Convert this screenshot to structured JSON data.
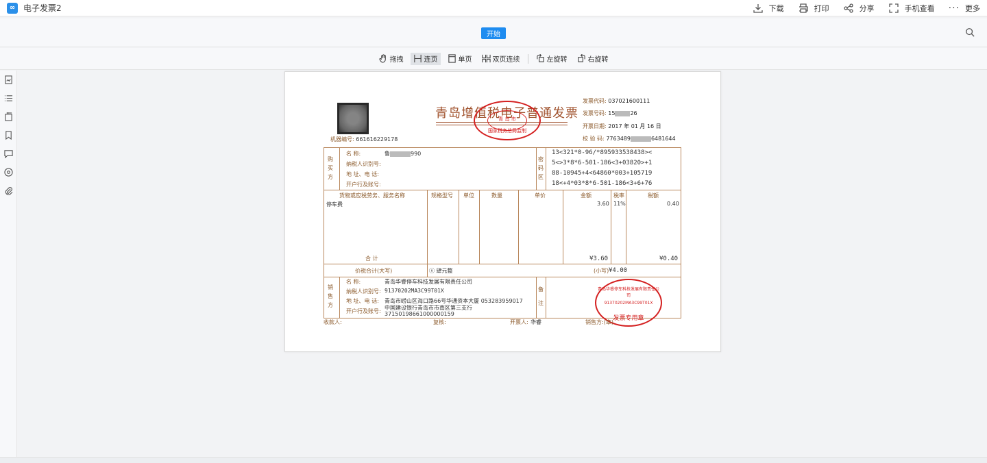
{
  "app": {
    "title": "电子发票2",
    "logo": "∞"
  },
  "top_actions": [
    {
      "label": "下载",
      "icon": "download-icon"
    },
    {
      "label": "打印",
      "icon": "printer-icon"
    },
    {
      "label": "分享",
      "icon": "share-icon"
    },
    {
      "label": "手机查看",
      "icon": "fullscreen-icon"
    },
    {
      "label": "更多",
      "icon": "more-icon"
    }
  ],
  "tab": {
    "start_label": "开始"
  },
  "tools": [
    {
      "label": "拖拽",
      "icon": "hand-icon",
      "active": false
    },
    {
      "label": "连页",
      "icon": "continuous-icon",
      "active": true
    },
    {
      "label": "单页",
      "icon": "single-page-icon",
      "active": false
    },
    {
      "label": "双页连续",
      "icon": "double-page-icon",
      "active": false
    },
    {
      "label": "左旋转",
      "icon": "rotate-left-icon",
      "active": false
    },
    {
      "label": "右旋转",
      "icon": "rotate-right-icon",
      "active": false
    }
  ],
  "sidebar_icons": [
    "thumbnail-icon",
    "outline-icon",
    "layers-icon",
    "bookmark-icon",
    "comment-icon",
    "signature-icon",
    "attachment-icon"
  ],
  "invoice": {
    "title": "青岛增值税电子普通发票",
    "machine_no_label": "机器编号:",
    "machine_no": "661616229178",
    "code_label": "发票代码:",
    "code": "037021600111",
    "number_label": "发票号码:",
    "number_prefix": "15",
    "number_suffix": "26",
    "date_label": "开票日期:",
    "date": "2017 年 01 月 16 日",
    "check_label": "校 验 码:",
    "check_prefix": "7763489",
    "check_suffix": "6481644",
    "seal_top_text": "国家税务总局监制",
    "seal_top_center": "青 岛 市",
    "buyer": {
      "side": "购买方",
      "name_label": "名        称:",
      "name_value_prefix": "鲁",
      "name_value_suffix": "990",
      "tax_label": "纳税人识别号:",
      "addr_label": "地 址、电 话:",
      "bank_label": "开户行及账号:"
    },
    "cipher": {
      "side": "密码区",
      "lines": [
        "13<321*0-96/*895933538438><",
        "5<>3*8*6-501-186<3+03820>+1",
        "88-10945+4<64860*003+105719",
        "18<+4*03*8*6-501-186<3+6+76"
      ]
    },
    "columns": [
      "货物或应税劳务、服务名称",
      "规格型号",
      "单位",
      "数量",
      "单价",
      "金额",
      "税率",
      "税额"
    ],
    "item": {
      "name": "停车费",
      "amount": "3.60",
      "rate": "11%",
      "tax": "0.40"
    },
    "total_label": "合      计",
    "total_amount": "¥3.60",
    "total_tax": "¥0.40",
    "sum_label": "价税合计(大写)",
    "sum_upper_icon": "ⓧ",
    "sum_upper": "肆元整",
    "sum_small_label": "(小写)",
    "sum_small": "¥4.00",
    "seller": {
      "side": "销售方",
      "name_label": "名        称:",
      "name": "青岛华睿停车科技发展有限责任公司",
      "tax_label": "纳税人识别号:",
      "tax_id": "91370202MA3C99T01X",
      "addr_label": "地 址、电 话:",
      "addr": "青岛市崂山区海口路66号华通资本大厦 053283959017",
      "bank_label": "开户行及账号:",
      "bank_line1": "中国建设银行青岛市市南区第三支行",
      "bank_line2": "37150198661000000159"
    },
    "remark_side": "备注",
    "seal_bottom_text": "青岛华睿停车科技发展有限责任公司",
    "seal_bottom_id": "91370202MA3C99T01X",
    "seal_bottom_label": "发票专用章",
    "payee_label": "收款人:",
    "reviewer_label": "复核:",
    "drawer_label": "开票人:",
    "drawer": "华睿",
    "seller_sign_label": "销售方:(章)"
  }
}
